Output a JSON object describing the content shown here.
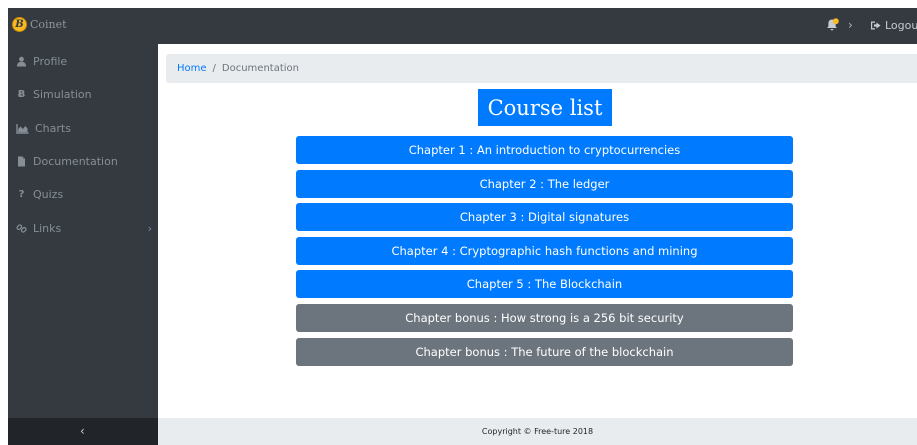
{
  "brand": {
    "name": "Coinet",
    "coin_glyph": "B",
    "coin_color": "#f7b924"
  },
  "topbar": {
    "notification_dot_color": "#f7b924",
    "notif_chevron": "›",
    "logout_label": "Logout"
  },
  "sidebar": {
    "items": [
      {
        "label": "Profile",
        "icon": "user-icon"
      },
      {
        "label": "Simulation",
        "icon": "bitcoin-icon",
        "glyph": "Ƀ"
      },
      {
        "label": "Charts",
        "icon": "area-chart-icon"
      },
      {
        "label": "Documentation",
        "icon": "file-icon"
      },
      {
        "label": "Quizs",
        "icon": "question-icon",
        "glyph": "?"
      },
      {
        "label": "Links",
        "icon": "link-icon",
        "chevron": "›"
      }
    ],
    "collapse_glyph": "‹"
  },
  "breadcrumb": {
    "home": "Home",
    "separator": "/",
    "current": "Documentation"
  },
  "main": {
    "title": "Course list",
    "chapters": [
      {
        "label": "Chapter 1 : An introduction to cryptocurrencies",
        "style": "primary"
      },
      {
        "label": "Chapter 2 : The ledger",
        "style": "primary"
      },
      {
        "label": "Chapter 3 : Digital signatures",
        "style": "primary"
      },
      {
        "label": "Chapter 4 : Cryptographic hash functions and mining",
        "style": "primary"
      },
      {
        "label": "Chapter 5 : The Blockchain",
        "style": "primary"
      },
      {
        "label": "Chapter bonus : How strong is a 256 bit security",
        "style": "secondary"
      },
      {
        "label": "Chapter bonus : The future of the blockchain",
        "style": "secondary"
      }
    ]
  },
  "footer": {
    "copyright": "Copyright © Free-ture 2018"
  },
  "colors": {
    "primary": "#007bff",
    "secondary": "#6c757d",
    "sidebar": "#343a40"
  }
}
